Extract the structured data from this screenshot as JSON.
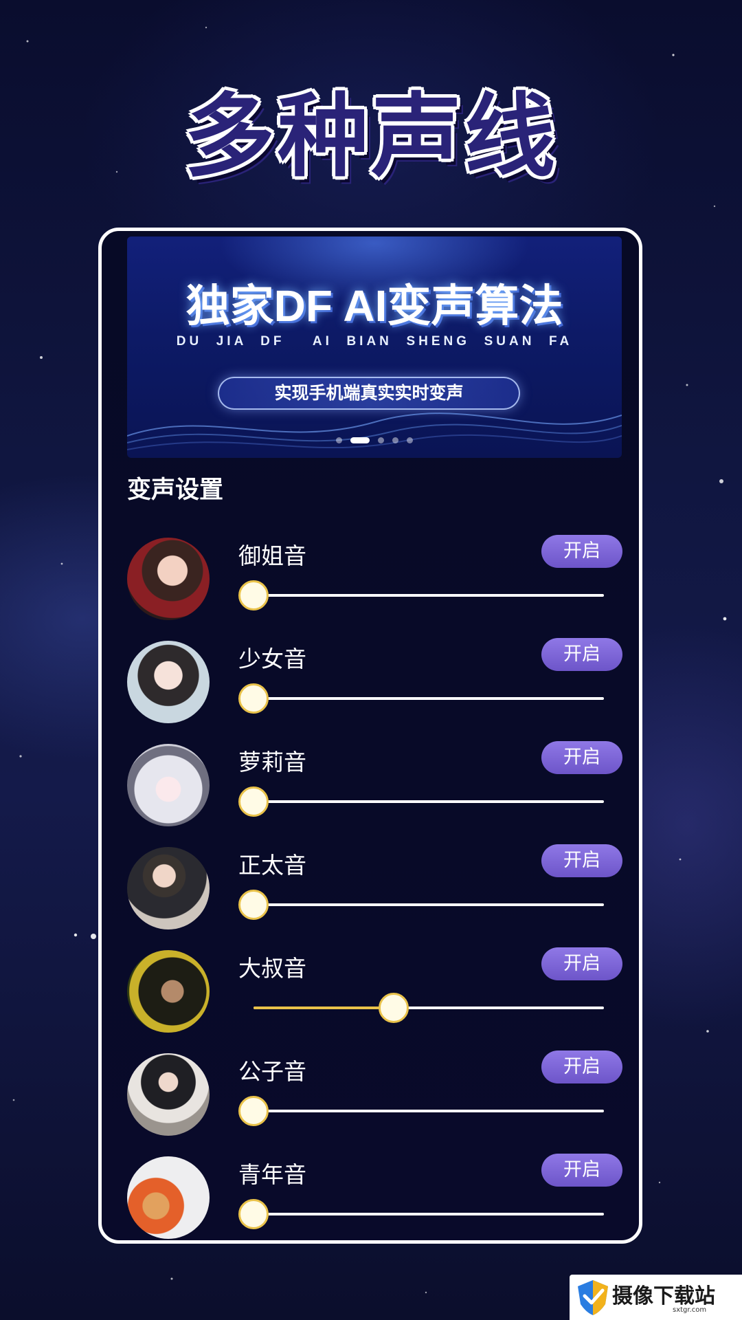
{
  "headline": "多种声线",
  "banner": {
    "title": "独家DF AI变声算法",
    "subtitle": "DU  JIA  DF    AI  BIAN  SHENG  SUAN  FA",
    "pill": "实现手机端真实实时变声",
    "carousel_dots": 5,
    "carousel_active_index": 1
  },
  "section_title": "变声设置",
  "voices": [
    {
      "name": "御姐音",
      "button": "开启",
      "level": 0.0,
      "avatar": "woman-portrait-avatar"
    },
    {
      "name": "少女音",
      "button": "开启",
      "level": 0.0,
      "avatar": "girl-portrait-avatar"
    },
    {
      "name": "萝莉音",
      "button": "开启",
      "level": 0.0,
      "avatar": "anime-girl-avatar"
    },
    {
      "name": "正太音",
      "button": "开启",
      "level": 0.0,
      "avatar": "boy-portrait-avatar"
    },
    {
      "name": "大叔音",
      "button": "开启",
      "level": 0.4,
      "avatar": "man-portrait-avatar"
    },
    {
      "name": "公子音",
      "button": "开启",
      "level": 0.0,
      "avatar": "costume-man-avatar"
    },
    {
      "name": "青年音",
      "button": "开启",
      "level": 0.0,
      "avatar": "young-person-avatar"
    }
  ],
  "watermark": {
    "text": "摄像下载站",
    "url": "sxtgr.com"
  },
  "colors": {
    "accent_button": "#7b63d6",
    "slider_active": "#e9c24a",
    "panel_border": "#ffffff"
  }
}
